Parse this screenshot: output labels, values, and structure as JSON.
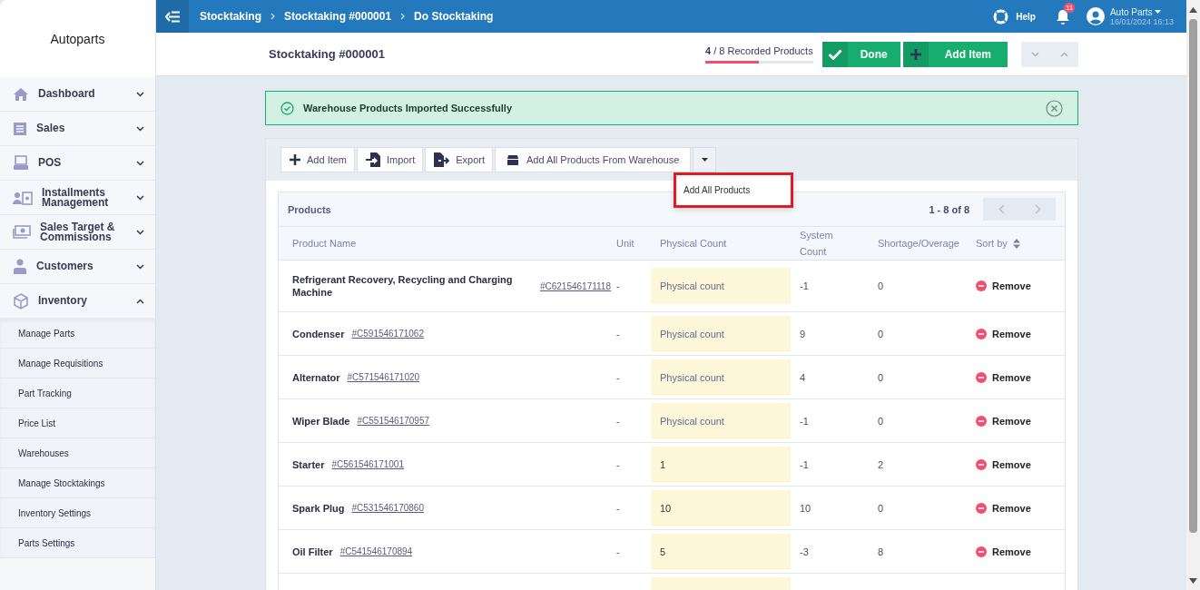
{
  "sidebar": {
    "brand": "Autoparts",
    "items": [
      {
        "label": "Dashboard",
        "expanded": false
      },
      {
        "label": "Sales",
        "expanded": false
      },
      {
        "label": "POS",
        "expanded": false
      },
      {
        "label": "Installments Management",
        "expanded": false
      },
      {
        "label": "Sales Target & Commissions",
        "expanded": false
      },
      {
        "label": "Customers",
        "expanded": false
      },
      {
        "label": "Inventory",
        "expanded": true,
        "children": [
          {
            "label": "Manage Parts"
          },
          {
            "label": "Manage Requisitions"
          },
          {
            "label": "Part Tracking"
          },
          {
            "label": "Price List"
          },
          {
            "label": "Warehouses"
          },
          {
            "label": "Manage Stocktakings"
          },
          {
            "label": "Inventory Settings"
          },
          {
            "label": "Parts Settings"
          }
        ]
      }
    ]
  },
  "topbar": {
    "breadcrumbs": [
      "Stocktaking",
      "Stocktaking #000001",
      "Do Stocktaking"
    ],
    "help": "Help",
    "notifications": "11",
    "user": "Auto Parts",
    "datetime": "16/01/2024 16:13"
  },
  "header": {
    "title": "Stocktaking #000001",
    "recorded": "4",
    "total": "/ 8 Recorded Products",
    "level": 0.5,
    "buttons": [
      {
        "label": "Done",
        "kind": "check"
      },
      {
        "label": "Add Item",
        "kind": "plus"
      }
    ]
  },
  "alert": {
    "message": "Warehouse Products Imported Successfully"
  },
  "toolbar": {
    "buttons": [
      {
        "label": "Add Item",
        "kind": "plus"
      },
      {
        "label": "Import",
        "kind": "import"
      },
      {
        "label": "Export",
        "kind": "export"
      },
      {
        "label": "Add All Products From Warehouse",
        "kind": "box"
      }
    ],
    "menu": [
      "Add All Products"
    ]
  },
  "products": {
    "title": "Products",
    "pagination": "1 - 8 of 8",
    "columns": [
      "Product Name",
      "Unit",
      "Physical Count",
      "System Count",
      "Shortage/Overage",
      "Sort by"
    ],
    "rows": [
      {
        "name": "Refrigerant Recovery, Recycling and Charging Machine",
        "code": "#C621546171118",
        "unit": "-",
        "placeholder": "Physical count",
        "system": "-1",
        "diff": "0",
        "action": "Remove"
      },
      {
        "name": "Condenser",
        "code": "#C591546171062",
        "unit": "-",
        "placeholder": "Physical count",
        "system": "9",
        "diff": "0",
        "action": "Remove"
      },
      {
        "name": "Alternator",
        "code": "#C571546171020",
        "unit": "-",
        "placeholder": "Physical count",
        "system": "4",
        "diff": "0",
        "action": "Remove"
      },
      {
        "name": "Wiper Blade",
        "code": "#C551546170957",
        "unit": "-",
        "placeholder": "Physical count",
        "system": "-1",
        "diff": "0",
        "action": "Remove"
      },
      {
        "name": "Starter",
        "code": "#C561546171001",
        "unit": "-",
        "value": "1",
        "system": "-1",
        "diff": "2",
        "action": "Remove"
      },
      {
        "name": "Spark Plug",
        "code": "#C531546170860",
        "unit": "-",
        "value": "10",
        "system": "10",
        "diff": "0",
        "action": "Remove"
      },
      {
        "name": "Oil Filter",
        "code": "#C541546170894",
        "unit": "-",
        "value": "5",
        "system": "-3",
        "diff": "8",
        "action": "Remove"
      }
    ]
  }
}
